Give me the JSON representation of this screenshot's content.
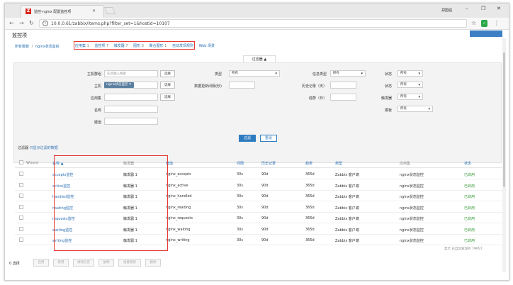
{
  "browser": {
    "tab_title": "监控-nginx 配置监控项",
    "user_label": "郑国强",
    "url": "10.0.0.61/zabbix/items.php?filter_set=1&hostid=10107"
  },
  "page": {
    "title": "监控项",
    "breadcrumb": {
      "all_hosts": "所有模板",
      "sep": "/",
      "template": "nginx状态监控",
      "links": [
        {
          "label": "应用集",
          "count": "1"
        },
        {
          "label": "监控项",
          "count": "7"
        },
        {
          "label": "触发器",
          "count": "7"
        },
        {
          "label": "图形",
          "count": "3"
        },
        {
          "label": "聚合图形",
          "count": "1"
        }
      ],
      "extra_links": [
        "自动发现规则",
        "Web 场景"
      ]
    },
    "filter_tab": "过滤器 ▲"
  },
  "filter": {
    "host_group_label": "主机群组",
    "host_group_placeholder": "在此输入搜索",
    "select": "选择",
    "host_label": "主机",
    "host_chip": "nginx状态监控",
    "app_label": "应用集",
    "name_label": "名称",
    "key_label": "键值",
    "type_label": "类型",
    "type_value": "所有",
    "update_interval_label": "数据更新间隔(秒)",
    "info_type_label": "信息类型",
    "info_type_value": "所有",
    "history_label": "历史记录（天）",
    "trend_label": "趋势（日）",
    "state_label": "状态",
    "state_value": "所有",
    "status_label": "状态",
    "status_value": "所有",
    "triggers_label": "触发器",
    "triggers_value": "所有",
    "template_label": "模板",
    "template_value": "所有",
    "apply": "过滤",
    "reset": "重设"
  },
  "table": {
    "filter_note_prefix": "过滤器",
    "filter_note": "只显示过滤的数据",
    "headers": {
      "wizard": "Wizard",
      "name": "名称 ▲",
      "triggers": "触发器",
      "key": "键值",
      "interval": "间隔",
      "history": "历史记录",
      "trends": "趋势",
      "type": "类型",
      "applications": "应用集",
      "status": "状态"
    },
    "rows": [
      {
        "name": "accepts监控",
        "triggers": "触发器 1",
        "key": "nginx_accepts",
        "interval": "30s",
        "history": "90d",
        "trends": "365d",
        "type": "Zabbix 客户端",
        "app": "nginx状态监控",
        "status": "已启用"
      },
      {
        "name": "active监控",
        "triggers": "触发器 1",
        "key": "nginx_active",
        "interval": "30s",
        "history": "90d",
        "trends": "365d",
        "type": "Zabbix 客户端",
        "app": "nginx状态监控",
        "status": "已启用"
      },
      {
        "name": "handled监控",
        "triggers": "触发器 1",
        "key": "nginx_handled",
        "interval": "30s",
        "history": "90d",
        "trends": "365d",
        "type": "Zabbix 客户端",
        "app": "nginx状态监控",
        "status": "已启用"
      },
      {
        "name": "reading监控",
        "triggers": "触发器 1",
        "key": "nginx_reading",
        "interval": "30s",
        "history": "90d",
        "trends": "365d",
        "type": "Zabbix 客户端",
        "app": "nginx状态监控",
        "status": "已启用"
      },
      {
        "name": "requests监控",
        "triggers": "触发器 1",
        "key": "nginx_requests",
        "interval": "30s",
        "history": "90d",
        "trends": "365d",
        "type": "Zabbix 客户端",
        "app": "nginx状态监控",
        "status": "已启用"
      },
      {
        "name": "waiting监控",
        "triggers": "触发器 1",
        "key": "nginx_waiting",
        "interval": "30s",
        "history": "90d",
        "trends": "365d",
        "type": "Zabbix 客户端",
        "app": "nginx状态监控",
        "status": "已启用"
      },
      {
        "name": "writing监控",
        "triggers": "触发器 1",
        "key": "nginx_writing",
        "interval": "30s",
        "history": "90d",
        "trends": "365d",
        "type": "Zabbix 客户端",
        "app": "nginx状态监控",
        "status": "已启用"
      }
    ],
    "display_note": "显示 已自动发现的 7中的7"
  },
  "bottom": {
    "count": "0 选择",
    "buttons": [
      "启用",
      "禁用",
      "清除历史",
      "复制",
      "批量更新",
      "删除"
    ]
  }
}
